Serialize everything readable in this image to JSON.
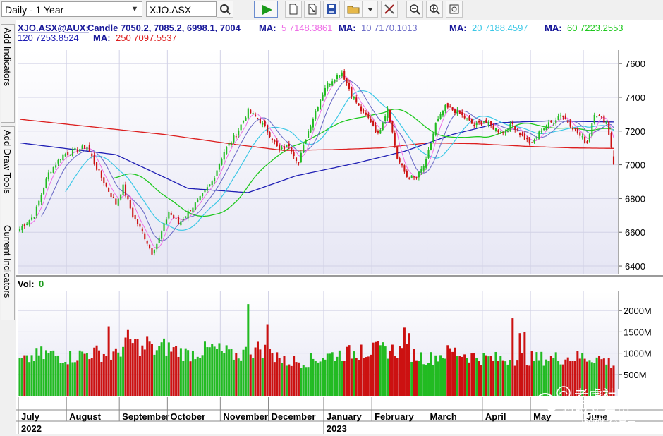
{
  "toolbar": {
    "period_select": "Daily - 1 Year",
    "symbol_input": "XJO.ASX",
    "icons": [
      "search-icon",
      "play-icon",
      "new-page-icon",
      "export-icon",
      "save-icon",
      "open-folder-icon",
      "dropdown-icon",
      "tools-icon",
      "zoom-out-icon",
      "zoom-in-icon",
      "fit-icon"
    ]
  },
  "sidebar": {
    "tabs": [
      "Add Indicators",
      "Add Draw Tools",
      "Current Indicators"
    ]
  },
  "legend": {
    "symbol": "XJO.ASX@AUX:",
    "candle": "Candle 7050.2, 7085.2, 6998.1, 7004",
    "ma_entries": [
      {
        "label": "MA:",
        "text": "5 7148.3861",
        "color": "#ee6ee6"
      },
      {
        "label": "MA:",
        "text": "10 7170.1013",
        "color": "#6e6ec8"
      },
      {
        "label": "MA:",
        "text": "20 7188.4597",
        "color": "#3cc8e6"
      },
      {
        "label": "MA:",
        "text": "60 7223.2553",
        "color": "#1ec81e"
      },
      {
        "label": "MA:",
        "text": "120 7253.8524",
        "color": "#1e1eb4"
      },
      {
        "label": "MA:",
        "text": "250 7097.5537",
        "color": "#dc1e1e"
      }
    ]
  },
  "vol_label": "Vol:",
  "vol_value": "0",
  "watermark": {
    "line1": "老虎社区",
    "line2": "澳股交易员",
    "line3": "@澳股交易员"
  },
  "chart_data": {
    "type": "candlestick",
    "x_axis": {
      "months": [
        "July",
        "August",
        "September",
        "October",
        "November",
        "December",
        "January",
        "February",
        "March",
        "April",
        "May",
        "June"
      ],
      "years": [
        "2022",
        "2023"
      ]
    },
    "price_axis": {
      "ticks": [
        6400,
        6600,
        6800,
        7000,
        7200,
        7400,
        7600
      ],
      "range": [
        6350,
        7680
      ]
    },
    "volume_axis": {
      "ticks": [
        "500M",
        "1000M",
        "1500M",
        "2000M"
      ],
      "tick_values": [
        500,
        1000,
        1500,
        2000
      ],
      "range": [
        0,
        2450
      ]
    },
    "grid": true,
    "close_key": [
      [
        0,
        6620
      ],
      [
        6,
        6700
      ],
      [
        12,
        6950
      ],
      [
        18,
        7060
      ],
      [
        24,
        7090
      ],
      [
        28,
        7110
      ],
      [
        32,
        6980
      ],
      [
        36,
        6870
      ],
      [
        40,
        6770
      ],
      [
        43,
        6870
      ],
      [
        47,
        6700
      ],
      [
        51,
        6600
      ],
      [
        55,
        6480
      ],
      [
        58,
        6560
      ],
      [
        62,
        6720
      ],
      [
        66,
        6650
      ],
      [
        70,
        6720
      ],
      [
        75,
        6800
      ],
      [
        80,
        6900
      ],
      [
        85,
        7080
      ],
      [
        90,
        7180
      ],
      [
        95,
        7320
      ],
      [
        100,
        7260
      ],
      [
        104,
        7180
      ],
      [
        108,
        7080
      ],
      [
        112,
        7120
      ],
      [
        116,
        7010
      ],
      [
        119,
        7160
      ],
      [
        123,
        7320
      ],
      [
        127,
        7460
      ],
      [
        131,
        7520
      ],
      [
        134,
        7550
      ],
      [
        138,
        7420
      ],
      [
        142,
        7320
      ],
      [
        146,
        7260
      ],
      [
        149,
        7180
      ],
      [
        153,
        7340
      ],
      [
        157,
        7040
      ],
      [
        161,
        6930
      ],
      [
        165,
        6920
      ],
      [
        169,
        7020
      ],
      [
        173,
        7240
      ],
      [
        177,
        7340
      ],
      [
        181,
        7320
      ],
      [
        185,
        7280
      ],
      [
        189,
        7230
      ],
      [
        193,
        7260
      ],
      [
        197,
        7220
      ],
      [
        201,
        7190
      ],
      [
        205,
        7240
      ],
      [
        209,
        7170
      ],
      [
        213,
        7120
      ],
      [
        217,
        7210
      ],
      [
        221,
        7250
      ],
      [
        225,
        7300
      ],
      [
        229,
        7240
      ],
      [
        233,
        7170
      ],
      [
        236,
        7130
      ],
      [
        239,
        7310
      ],
      [
        242,
        7270
      ],
      [
        244,
        7260
      ],
      [
        246,
        7110
      ],
      [
        247,
        7004
      ]
    ],
    "volume_key": [
      [
        0,
        800
      ],
      [
        10,
        1000
      ],
      [
        20,
        900
      ],
      [
        30,
        1020
      ],
      [
        40,
        950
      ],
      [
        45,
        1300
      ],
      [
        55,
        1050
      ],
      [
        60,
        1150
      ],
      [
        70,
        980
      ],
      [
        80,
        1100
      ],
      [
        90,
        950
      ],
      [
        100,
        1120
      ],
      [
        110,
        800
      ],
      [
        120,
        830
      ],
      [
        130,
        960
      ],
      [
        140,
        1020
      ],
      [
        150,
        1080
      ],
      [
        160,
        1050
      ],
      [
        170,
        860
      ],
      [
        180,
        1050
      ],
      [
        190,
        900
      ],
      [
        200,
        860
      ],
      [
        210,
        870
      ],
      [
        220,
        880
      ],
      [
        230,
        900
      ],
      [
        240,
        900
      ],
      [
        247,
        750
      ]
    ],
    "volume_spikes": [
      [
        3,
        950
      ],
      [
        10,
        860
      ],
      [
        37,
        1630
      ],
      [
        50,
        940
      ],
      [
        51,
        1180
      ],
      [
        53,
        1400
      ],
      [
        54,
        1270
      ],
      [
        85,
        1000
      ],
      [
        88,
        1100
      ],
      [
        95,
        2150
      ],
      [
        103,
        1680
      ],
      [
        107,
        1020
      ],
      [
        142,
        1200
      ],
      [
        160,
        1600
      ],
      [
        162,
        1470
      ],
      [
        205,
        1820
      ],
      [
        208,
        1470
      ],
      [
        210,
        1490
      ],
      [
        234,
        1010
      ]
    ],
    "ma_final": {
      "5": 7148.3861,
      "10": 7170.1013,
      "20": 7188.4597,
      "60": 7223.2553,
      "120": 7253.8524,
      "250": 7097.5537
    },
    "ma250_start": 7270,
    "ma250_key": [
      [
        0,
        7270
      ],
      [
        60,
        7180
      ],
      [
        90,
        7120
      ],
      [
        110,
        7085
      ],
      [
        130,
        7090
      ],
      [
        150,
        7100
      ],
      [
        170,
        7130
      ],
      [
        190,
        7125
      ],
      [
        210,
        7110
      ],
      [
        230,
        7100
      ],
      [
        247,
        7097.5537
      ]
    ],
    "ma120_start": 7130,
    "ma120_key": [
      [
        0,
        7130
      ],
      [
        40,
        7060
      ],
      [
        70,
        6860
      ],
      [
        95,
        6835
      ],
      [
        115,
        6935
      ],
      [
        140,
        7010
      ],
      [
        160,
        7080
      ],
      [
        180,
        7180
      ],
      [
        200,
        7250
      ],
      [
        220,
        7260
      ],
      [
        247,
        7253.8524
      ]
    ],
    "last_candle": {
      "open": 7050.2,
      "high": 7085.2,
      "low": 6998.1,
      "close": 7004
    }
  },
  "colors": {
    "up": "#22bb22",
    "down": "#cc1111",
    "grid": "#d2d2e6",
    "plot_bg_top": "#ffffff",
    "plot_bg_bottom": "#e8e8f5"
  }
}
